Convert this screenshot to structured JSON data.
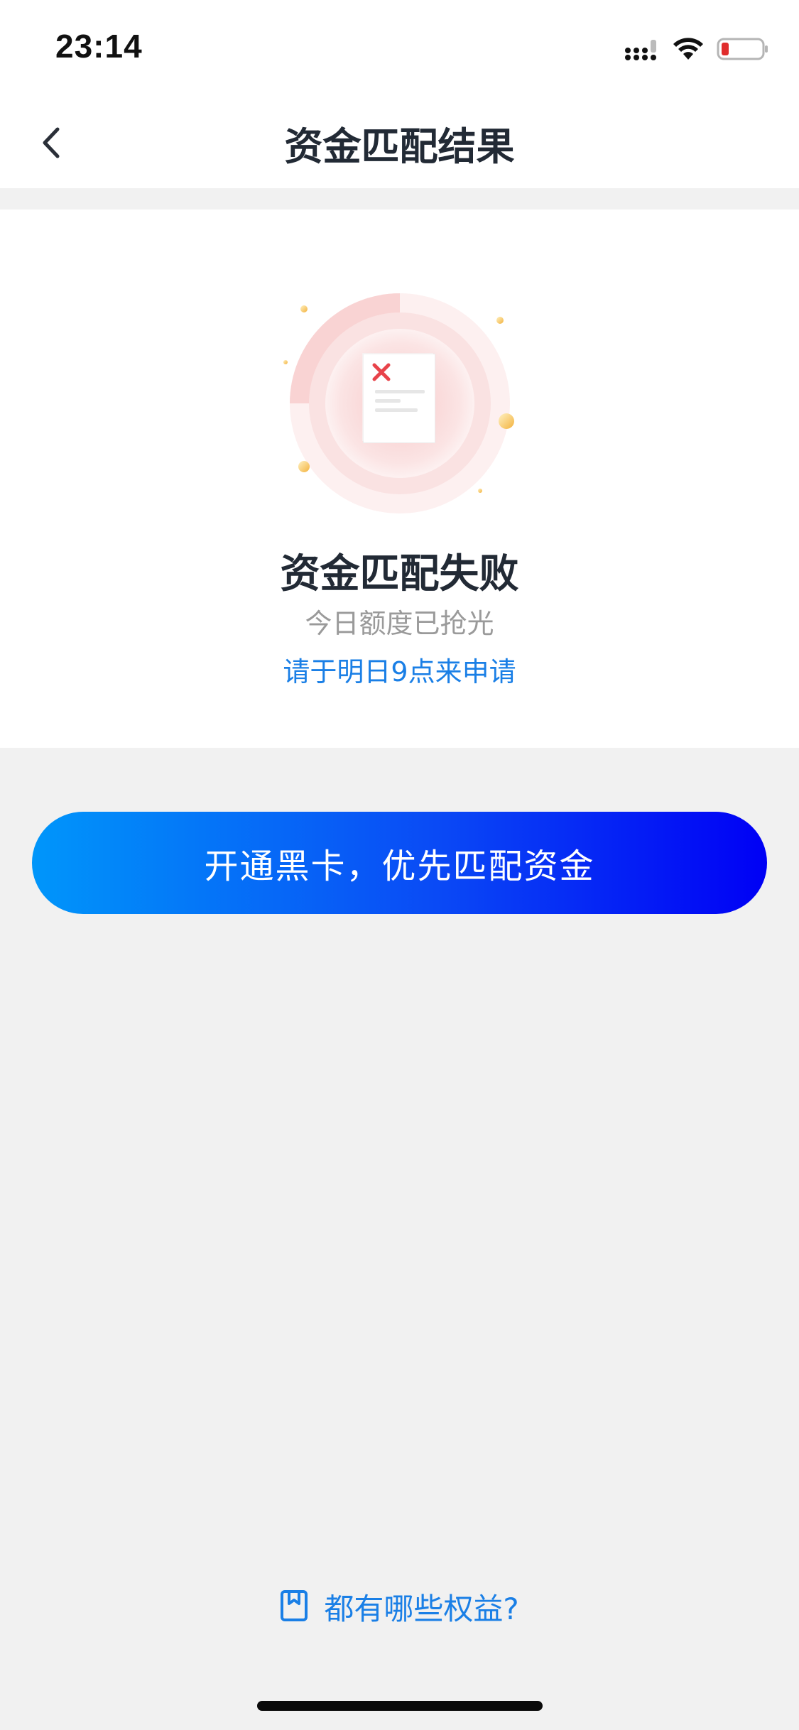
{
  "status_bar": {
    "time": "23:14",
    "icons": [
      "signal-icon",
      "wifi-icon",
      "battery-low-icon"
    ]
  },
  "nav": {
    "title": "资金匹配结果",
    "back_icon": "chevron-left-icon"
  },
  "result": {
    "illustration": "match-failed-document-icon",
    "title": "资金匹配失败",
    "subtitle": "今日额度已抢光",
    "hint": "请于明日9点来申请"
  },
  "primary_button": {
    "label": "开通黑卡，优先匹配资金"
  },
  "benefits_link": {
    "icon": "bookmark-card-icon",
    "label": "都有哪些权益?"
  },
  "colors": {
    "accent_blue": "#1a7fe6",
    "button_gradient_start": "#0096fa",
    "button_gradient_end": "#0000f5",
    "error_red": "#e8434a",
    "background": "#f1f1f1"
  }
}
